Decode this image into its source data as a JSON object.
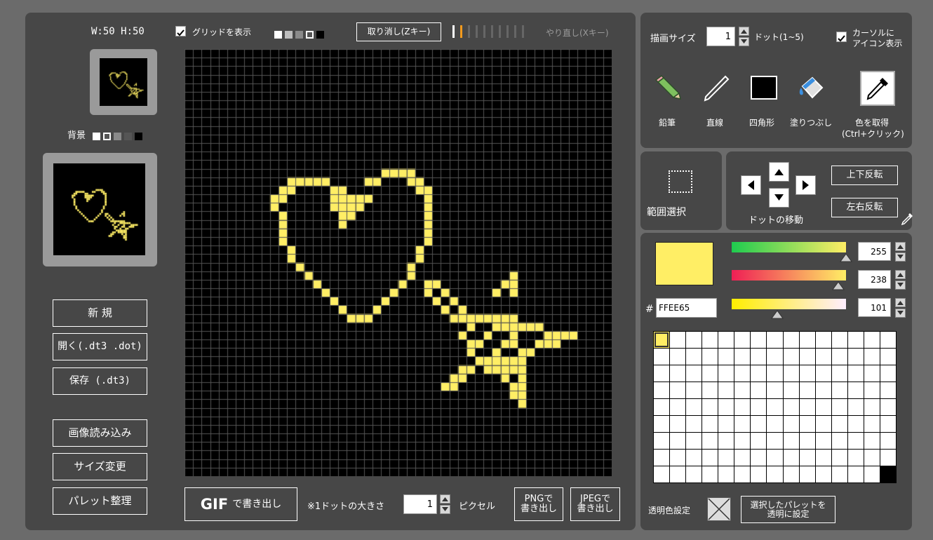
{
  "left": {
    "size_text": "W:50 H:50",
    "bg_label": "背景",
    "bg_swatches": [
      "#ffffff",
      "#bdbdbd",
      "#8a8a8a",
      "#555555",
      "#000000"
    ],
    "buttons": {
      "new": "新 規",
      "open": "開く(.dt3 .dot)",
      "save": "保存 (.dt3)",
      "import": "画像読み込み",
      "resize": "サイズ変更",
      "palette": "パレット整理"
    }
  },
  "toolbar": {
    "grid_label": "グリッドを表示",
    "grid_checked": true,
    "grid_swatches": [
      "#ffffff",
      "#bdbdbd",
      "#8a8a8a",
      "#555555",
      "#000000"
    ],
    "undo_label": "取り消し(Zキー)",
    "redo_label": "やり直し(Xキー)",
    "history_selected": 1,
    "history_count": 10
  },
  "bottom": {
    "gif_big": "GIF",
    "gif_small": "で書き出し",
    "dot_size_label": "※1ドットの大きさ",
    "dot_size_value": "1",
    "pixel_label": "ピクセル",
    "png_line1": "PNGで",
    "png_line2": "書き出し",
    "jpeg_line1": "JPEGで",
    "jpeg_line2": "書き出し"
  },
  "tools": {
    "draw_size_label": "描画サイズ",
    "draw_size_value": "1",
    "dot_range_label": "ドット(1~5)",
    "cursor_label_1": "カーソルに",
    "cursor_label_2": "アイコン表示",
    "cursor_checked": true,
    "pencil": "鉛筆",
    "line": "直線",
    "rect": "四角形",
    "fill": "塗りつぶし",
    "pick_1": "色を取得",
    "pick_2": "(Ctrl+クリック)",
    "selected_tool": "picker"
  },
  "transform": {
    "select_label": "範囲選択",
    "move_label": "ドットの移動",
    "flip_v": "上下反転",
    "flip_h": "左右反転"
  },
  "color": {
    "current_hex_color": "#FFEE65",
    "hash": "#",
    "hex_value": "FFEE65",
    "r": "255",
    "g": "238",
    "b": "101",
    "r_level": 1.0,
    "g_level": 0.933,
    "b_level": 0.396
  },
  "palette": {
    "cols": 15,
    "rows": 9,
    "first": "#FFEE65",
    "last": "#000000",
    "transparent_label": "透明色設定",
    "set_transparent_1": "選択したパレットを",
    "set_transparent_2": "透明に設定"
  },
  "canvas": {
    "cols": 50,
    "rows": 50,
    "pixel_color": "#FFEE65",
    "pixels": [
      [
        12,
        15
      ],
      [
        13,
        15
      ],
      [
        14,
        15
      ],
      [
        15,
        15
      ],
      [
        16,
        15
      ],
      [
        23,
        14
      ],
      [
        24,
        14
      ],
      [
        25,
        14
      ],
      [
        26,
        14
      ],
      [
        11,
        16
      ],
      [
        12,
        16
      ],
      [
        17,
        16
      ],
      [
        18,
        16
      ],
      [
        21,
        15
      ],
      [
        22,
        15
      ],
      [
        26,
        15
      ],
      [
        27,
        15
      ],
      [
        10,
        17
      ],
      [
        11,
        17
      ],
      [
        17,
        17
      ],
      [
        18,
        17
      ],
      [
        19,
        17
      ],
      [
        20,
        17
      ],
      [
        21,
        17
      ],
      [
        27,
        16
      ],
      [
        28,
        16
      ],
      [
        10,
        18
      ],
      [
        17,
        18
      ],
      [
        18,
        18
      ],
      [
        19,
        18
      ],
      [
        20,
        18
      ],
      [
        28,
        17
      ],
      [
        28,
        18
      ],
      [
        11,
        19
      ],
      [
        18,
        19
      ],
      [
        19,
        19
      ],
      [
        28,
        19
      ],
      [
        18,
        20
      ],
      [
        28,
        20
      ],
      [
        11,
        20
      ],
      [
        11,
        21
      ],
      [
        28,
        21
      ],
      [
        11,
        22
      ],
      [
        28,
        22
      ],
      [
        12,
        23
      ],
      [
        27,
        23
      ],
      [
        12,
        24
      ],
      [
        27,
        24
      ],
      [
        13,
        25
      ],
      [
        26,
        25
      ],
      [
        14,
        26
      ],
      [
        26,
        26
      ],
      [
        15,
        27
      ],
      [
        25,
        27
      ],
      [
        16,
        28
      ],
      [
        24,
        28
      ],
      [
        17,
        29
      ],
      [
        23,
        29
      ],
      [
        18,
        30
      ],
      [
        22,
        30
      ],
      [
        19,
        31
      ],
      [
        20,
        31
      ],
      [
        21,
        31
      ],
      [
        28,
        27
      ],
      [
        29,
        27
      ],
      [
        28,
        28
      ],
      [
        30,
        28
      ],
      [
        38,
        26
      ],
      [
        29,
        29
      ],
      [
        31,
        29
      ],
      [
        37,
        27
      ],
      [
        38,
        27
      ],
      [
        30,
        30
      ],
      [
        32,
        30
      ],
      [
        36,
        28
      ],
      [
        38,
        28
      ],
      [
        31,
        31
      ],
      [
        32,
        31
      ],
      [
        33,
        31
      ],
      [
        34,
        31
      ],
      [
        35,
        31
      ],
      [
        36,
        31
      ],
      [
        37,
        31
      ],
      [
        38,
        31
      ],
      [
        33,
        32
      ],
      [
        36,
        32
      ],
      [
        37,
        32
      ],
      [
        38,
        32
      ],
      [
        39,
        32
      ],
      [
        40,
        32
      ],
      [
        41,
        32
      ],
      [
        32,
        33
      ],
      [
        35,
        33
      ],
      [
        38,
        33
      ],
      [
        42,
        33
      ],
      [
        43,
        33
      ],
      [
        44,
        33
      ],
      [
        45,
        33
      ],
      [
        33,
        34
      ],
      [
        34,
        34
      ],
      [
        37,
        34
      ],
      [
        38,
        34
      ],
      [
        41,
        34
      ],
      [
        42,
        34
      ],
      [
        43,
        34
      ],
      [
        33,
        35
      ],
      [
        36,
        35
      ],
      [
        39,
        35
      ],
      [
        40,
        35
      ],
      [
        34,
        36
      ],
      [
        35,
        36
      ],
      [
        36,
        36
      ],
      [
        37,
        36
      ],
      [
        38,
        36
      ],
      [
        39,
        36
      ],
      [
        32,
        37
      ],
      [
        33,
        37
      ],
      [
        35,
        37
      ],
      [
        36,
        37
      ],
      [
        37,
        37
      ],
      [
        38,
        37
      ],
      [
        39,
        37
      ],
      [
        31,
        38
      ],
      [
        32,
        38
      ],
      [
        37,
        38
      ],
      [
        39,
        38
      ],
      [
        30,
        39
      ],
      [
        31,
        39
      ],
      [
        38,
        39
      ],
      [
        39,
        39
      ],
      [
        38,
        40
      ],
      [
        39,
        40
      ],
      [
        39,
        41
      ]
    ]
  }
}
